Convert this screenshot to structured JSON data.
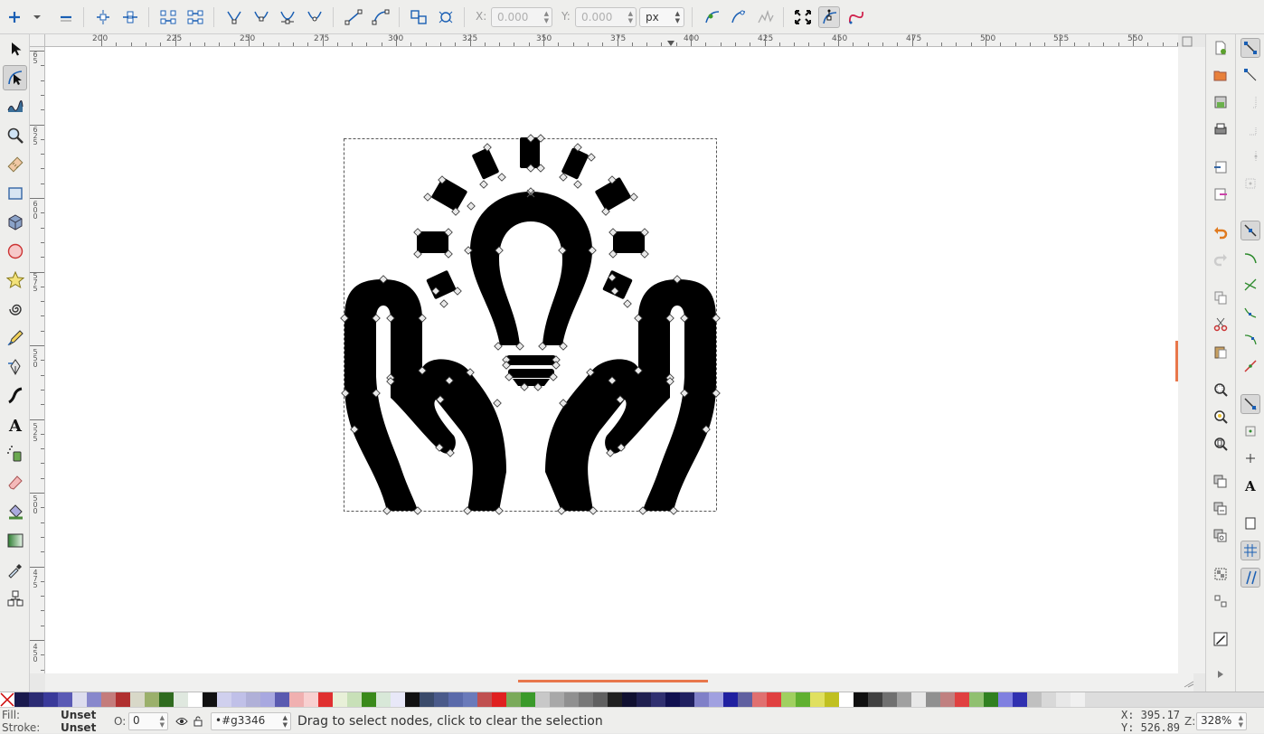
{
  "toolbar": {
    "x_label": "X:",
    "x_value": "0.000",
    "y_label": "Y:",
    "y_value": "0.000",
    "unit": "px"
  },
  "ruler": {
    "h_labels": [
      "200",
      "225",
      "250",
      "275",
      "300",
      "325",
      "350",
      "375",
      "400",
      "425",
      "450",
      "475",
      "500",
      "525",
      "550"
    ]
  },
  "status": {
    "fill_label": "Fill:",
    "fill_value": "Unset",
    "stroke_label": "Stroke:",
    "stroke_value": "Unset",
    "opacity_label": "O:",
    "opacity_value": "0",
    "layer": "•#g3346",
    "message": "Drag to select nodes, click to clear the selection",
    "x_coord": "X:  395.17",
    "y_coord": "Y:  526.89",
    "zoom_label": "Z:",
    "zoom_value": "328%"
  },
  "palette": [
    "#1a1a4e",
    "#2b2b73",
    "#3a3a9a",
    "#5a5ab5",
    "#dde",
    "#8888cc",
    "#c47c7c",
    "#b03030",
    "#d8d8c8",
    "#9bb06b",
    "#2f6b1f",
    "#dfe8df",
    "#ffffff",
    "#111111",
    "#d0d0ee",
    "#c0c0e8",
    "#b0b0d8",
    "#a8a8e0",
    "#5a5ab0",
    "#f0b0b0",
    "#f8d0d0",
    "#e03030",
    "#e8f0d8",
    "#c8e0b8",
    "#3a8a1a",
    "#d8e8d8",
    "#e8e8f8",
    "#111111",
    "#3a4a6a",
    "#4a5a8a",
    "#5a6aaa",
    "#6a7aba",
    "#c05050",
    "#e02020",
    "#7aaa5a",
    "#3a9a2a",
    "#c8c8c8",
    "#a8a8a8",
    "#909090",
    "#787878",
    "#606060",
    "#202020",
    "#101030",
    "#202050",
    "#303070",
    "#101050",
    "#202060",
    "#8080c8",
    "#a0a0e0",
    "#2020a0",
    "#6060a0",
    "#e07070",
    "#e04040",
    "#a0d060",
    "#60b030",
    "#e0e060",
    "#c0c020",
    "#ffffff",
    "#101010",
    "#404040",
    "#707070",
    "#a0a0a0",
    "#e8e8e8",
    "#909090",
    "#c08080",
    "#e04040",
    "#90c070",
    "#308020",
    "#8080e0",
    "#3030b0",
    "#c0c0c0",
    "#d8d8d8",
    "#e8e8e8",
    "#f0f0f0"
  ]
}
